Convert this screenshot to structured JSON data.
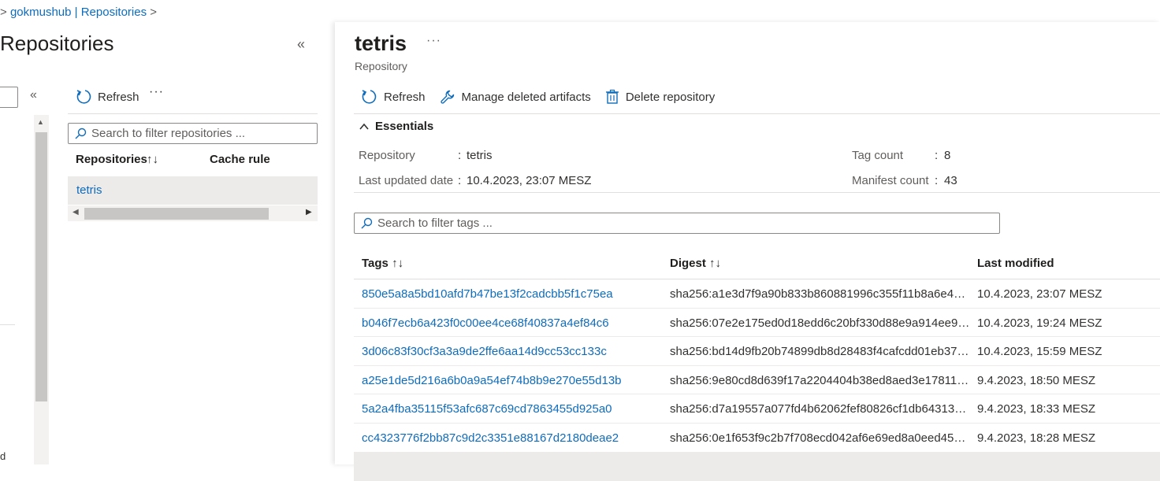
{
  "breadcrumb": {
    "items": [
      "gokmushub | Repositories"
    ]
  },
  "left_blade": {
    "title": "Repositories",
    "collapse_glyph": "«",
    "menu_collapse_glyph": "«",
    "menu_clipped_text": "d",
    "toolbar": {
      "refresh_label": "Refresh",
      "more_glyph": "···"
    },
    "search_placeholder": "Search to filter repositories ...",
    "columns": [
      "Repositories",
      "Cache rule"
    ],
    "sort_glyph": "↑↓",
    "rows": [
      {
        "name": "tetris"
      }
    ]
  },
  "repo": {
    "title": "tetris",
    "more_glyph": "···",
    "subtitle": "Repository",
    "toolbar": {
      "refresh_label": "Refresh",
      "manage_label": "Manage deleted artifacts",
      "delete_label": "Delete repository"
    },
    "essentials": {
      "label": "Essentials",
      "repository_label": "Repository",
      "repository_value": "tetris",
      "last_updated_label": "Last updated date",
      "last_updated_value": "10.4.2023, 23:07 MESZ",
      "tag_count_label": "Tag count",
      "tag_count_value": "8",
      "manifest_count_label": "Manifest count",
      "manifest_count_value": "43",
      "colon": ":"
    },
    "tag_search_placeholder": "Search to filter tags ...",
    "columns": {
      "tags": "Tags",
      "digest": "Digest",
      "last_modified": "Last modified"
    },
    "sort_glyph": "↑↓",
    "tags": [
      {
        "tag": "850e5a8a5bd10afd7b47be13f2cadcbb5f1c75ea",
        "digest": "sha256:a1e3d7f9a90b833b860881996c355f11b8a6e4b8...",
        "modified": "10.4.2023, 23:07 MESZ"
      },
      {
        "tag": "b046f7ecb6a423f0c00ee4ce68f40837a4ef84c6",
        "digest": "sha256:07e2e175ed0d18edd6c20bf330d88e9a914ee95...",
        "modified": "10.4.2023, 19:24 MESZ"
      },
      {
        "tag": "3d06c83f30cf3a3a9de2ffe6aa14d9cc53cc133c",
        "digest": "sha256:bd14d9fb20b74899db8d28483f4cafcdd01eb372...",
        "modified": "10.4.2023, 15:59 MESZ"
      },
      {
        "tag": "a25e1de5d216a6b0a9a54ef74b8b9e270e55d13b",
        "digest": "sha256:9e80cd8d639f17a2204404b38ed8aed3e1781160...",
        "modified": "9.4.2023, 18:50 MESZ"
      },
      {
        "tag": "5a2a4fba35115f53afc687c69cd7863455d925a0",
        "digest": "sha256:d7a19557a077fd4b62062fef80826cf1db64313c7...",
        "modified": "9.4.2023, 18:33 MESZ"
      },
      {
        "tag": "cc4323776f2bb87c9d2c3351e88167d2180deae2",
        "digest": "sha256:0e1f653f9c2b7f708ecd042af6e69ed8a0eed4544...",
        "modified": "9.4.2023, 18:28 MESZ"
      }
    ]
  },
  "colors": {
    "link": "#0f6cbd",
    "selected_row": "#edebe9",
    "border": "#e1dfdd"
  }
}
